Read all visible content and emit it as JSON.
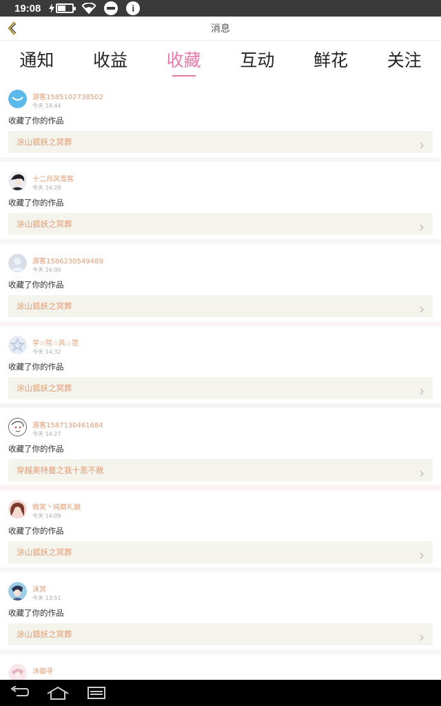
{
  "status_bar": {
    "time": "19:08",
    "battery_level": 0.55,
    "icons": [
      "charging-bolt-icon",
      "battery-icon",
      "wifi-icon",
      "do-not-disturb-icon",
      "info-icon"
    ]
  },
  "header": {
    "title": "消息",
    "back_icon": "chevron-left-icon"
  },
  "tabs": [
    {
      "label": "通知",
      "active": false
    },
    {
      "label": "收益",
      "active": false
    },
    {
      "label": "收藏",
      "active": true
    },
    {
      "label": "互动",
      "active": false
    },
    {
      "label": "鲜花",
      "active": false
    },
    {
      "label": "关注",
      "active": false
    }
  ],
  "colors": {
    "accent_pink": "#e879a8",
    "name_orange": "#e29b75",
    "card_bg": "#f5f4ec"
  },
  "messages": [
    {
      "user": "游客1585102738502",
      "time": "今天 18:44",
      "action": "收藏了你的作品",
      "work": "涂山狐妖之冥葬",
      "avatar": "smile-avatar"
    },
    {
      "user": "十二月风雪客",
      "time": "今天 16:28",
      "action": "收藏了你的作品",
      "work": "涂山狐妖之冥葬",
      "avatar": "character-avatar"
    },
    {
      "user": "游客1586230549489",
      "time": "今天 16:00",
      "action": "收藏了你的作品",
      "work": "涂山狐妖之冥葬",
      "avatar": "default-avatar"
    },
    {
      "user": "学☆院☆风☆范",
      "time": "今天 14:32",
      "action": "收藏了你的作品",
      "work": "涂山狐妖之冥葬",
      "avatar": "star-avatar"
    },
    {
      "user": "游客1587130461684",
      "time": "今天 14:27",
      "action": "收藏了你的作品",
      "work": "穿越奥特曼之我十恶不赦",
      "avatar": "sketch-avatar"
    },
    {
      "user": "微笑丶纯腐礼貌",
      "time": "今天 14:09",
      "action": "收藏了你的作品",
      "work": "涂山狐妖之冥葬",
      "avatar": "girl-avatar"
    },
    {
      "user": "沫冥",
      "time": "今天 13:51",
      "action": "收藏了你的作品",
      "work": "涂山狐妖之冥葬",
      "avatar": "anime-avatar"
    },
    {
      "user": "沐御寻",
      "time": "",
      "action": "",
      "work": "",
      "avatar": "pink-avatar"
    }
  ],
  "nav_bar": {
    "icons": [
      "back-arrow-icon",
      "home-icon",
      "recent-apps-icon"
    ]
  }
}
